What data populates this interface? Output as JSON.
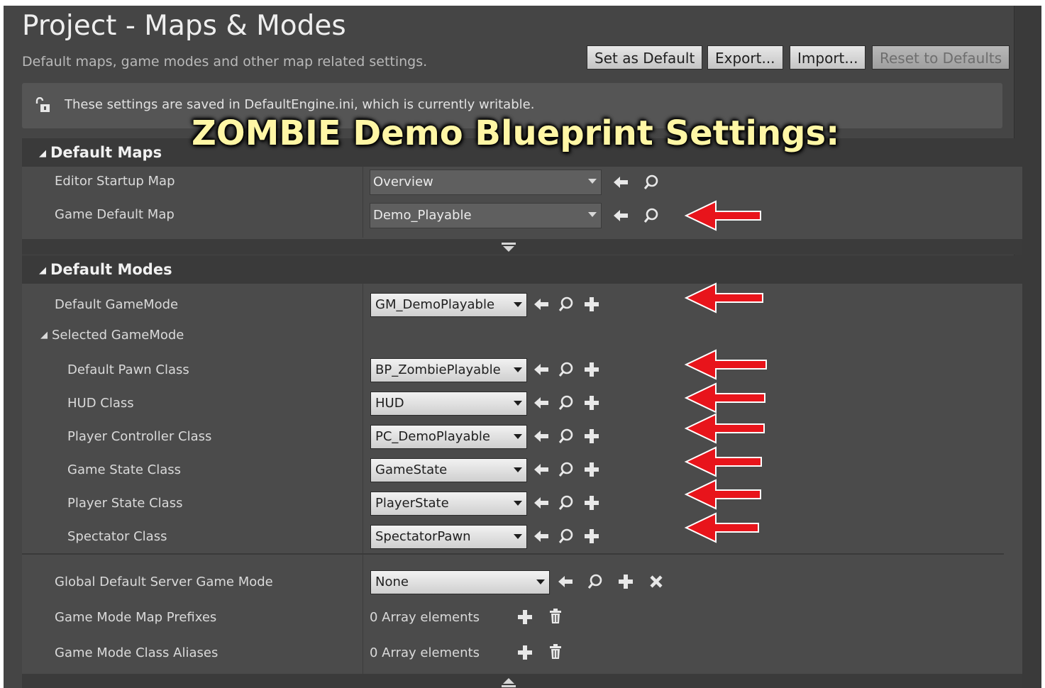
{
  "header": {
    "title": "Project - Maps & Modes",
    "subtitle": "Default maps, game modes and other map related settings.",
    "buttons": {
      "set_default": "Set as Default",
      "export": "Export...",
      "import": "Import...",
      "reset": "Reset to Defaults"
    }
  },
  "notice": {
    "text": "These settings are saved in DefaultEngine.ini, which is currently writable."
  },
  "overlay": {
    "title": "ZOMBIE Demo Blueprint Settings:"
  },
  "default_maps": {
    "title": "Default Maps",
    "rows": [
      {
        "label": "Editor Startup Map",
        "value": "Overview"
      },
      {
        "label": "Game Default Map",
        "value": "Demo_Playable"
      }
    ]
  },
  "default_modes": {
    "title": "Default Modes",
    "default_gamemode": {
      "label": "Default GameMode",
      "value": "GM_DemoPlayable"
    },
    "selected_gamemode": {
      "label": "Selected GameMode"
    },
    "classes": [
      {
        "label": "Default Pawn Class",
        "value": "BP_ZombiePlayable"
      },
      {
        "label": "HUD Class",
        "value": "HUD"
      },
      {
        "label": "Player Controller Class",
        "value": "PC_DemoPlayable"
      },
      {
        "label": "Game State Class",
        "value": "GameState"
      },
      {
        "label": "Player State Class",
        "value": "PlayerState"
      },
      {
        "label": "Spectator Class",
        "value": "SpectatorPawn"
      }
    ],
    "global_server_mode": {
      "label": "Global Default Server Game Mode",
      "value": "None"
    },
    "map_prefixes": {
      "label": "Game Mode Map Prefixes",
      "value": "0 Array elements"
    },
    "class_aliases": {
      "label": "Game Mode Class Aliases",
      "value": "0 Array elements"
    }
  },
  "colors": {
    "panel": "#454545",
    "section": "#4b4b4b",
    "header": "#3a3a3a",
    "overlay_text": "#fff6a5",
    "annotation_arrow": "#e8141b"
  }
}
